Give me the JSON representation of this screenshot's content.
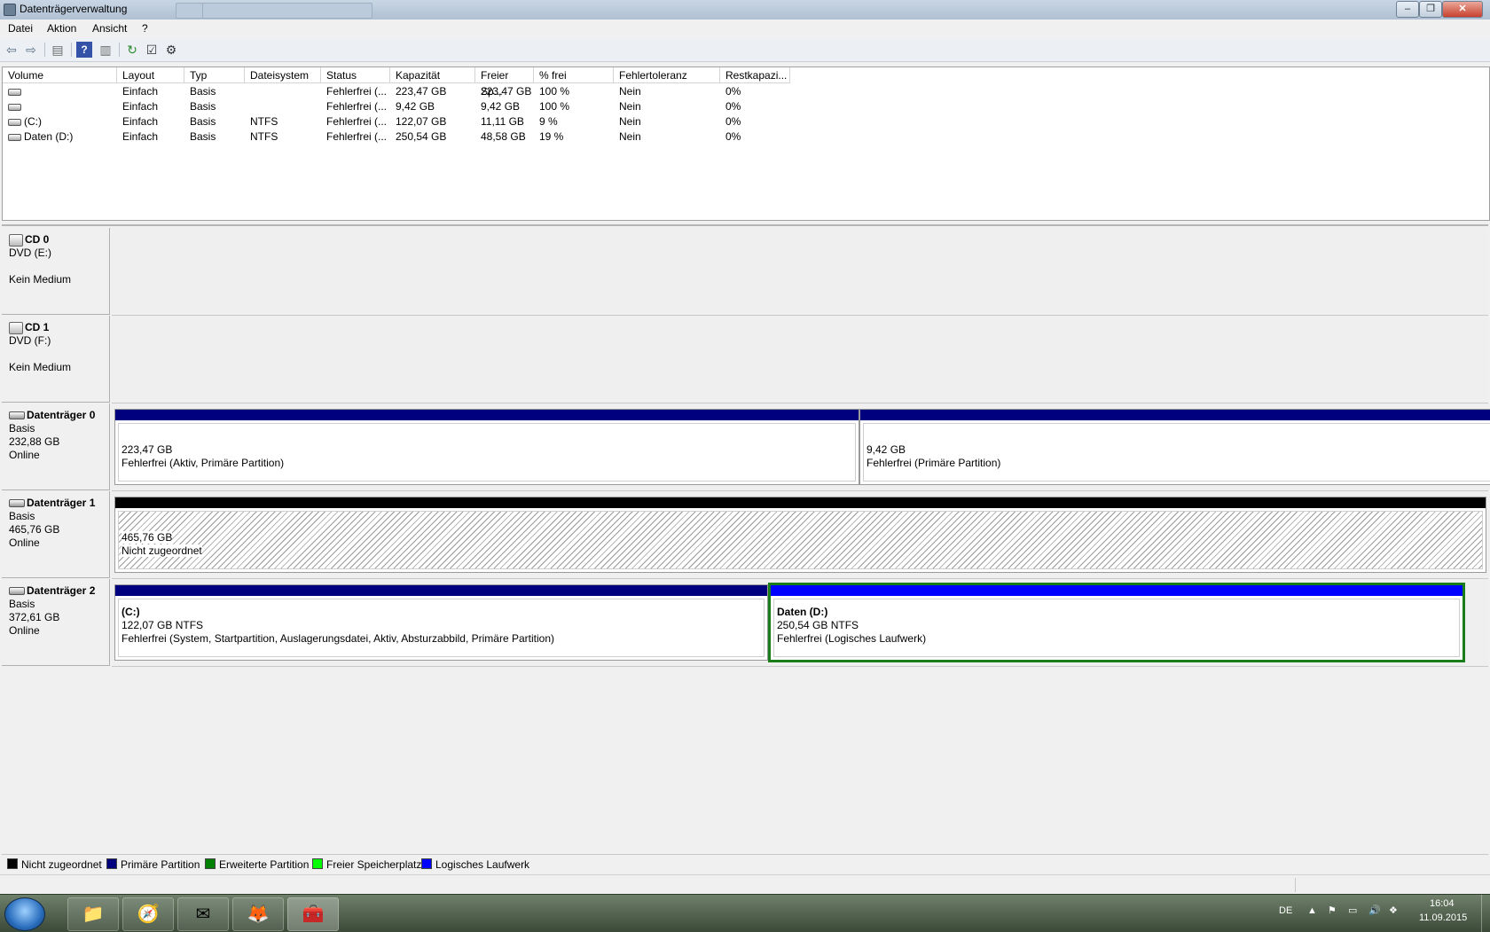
{
  "window": {
    "title": "Datenträgerverwaltung"
  },
  "menu": [
    "Datei",
    "Aktion",
    "Ansicht",
    "?"
  ],
  "toolbar": {
    "buttons": [
      "back-arrow-icon",
      "forward-arrow-icon",
      "console-tree-icon",
      "help-icon",
      "show-pane-icon",
      "refresh-icon",
      "properties-icon",
      "settings-icon"
    ]
  },
  "volume_table": {
    "columns": [
      "Volume",
      "Layout",
      "Typ",
      "Dateisystem",
      "Status",
      "Kapazität",
      "Freier Sp...",
      "% frei",
      "Fehlertoleranz",
      "Restkapazi..."
    ],
    "rows": [
      [
        "",
        "Einfach",
        "Basis",
        "",
        "Fehlerfrei (...",
        "223,47 GB",
        "223,47 GB",
        "100 %",
        "Nein",
        "0%"
      ],
      [
        "",
        "Einfach",
        "Basis",
        "",
        "Fehlerfrei (...",
        "9,42 GB",
        "9,42 GB",
        "100 %",
        "Nein",
        "0%"
      ],
      [
        "(C:)",
        "Einfach",
        "Basis",
        "NTFS",
        "Fehlerfrei (...",
        "122,07 GB",
        "11,11 GB",
        "9 %",
        "Nein",
        "0%"
      ],
      [
        "Daten (D:)",
        "Einfach",
        "Basis",
        "NTFS",
        "Fehlerfrei (...",
        "250,54 GB",
        "48,58 GB",
        "19 %",
        "Nein",
        "0%"
      ]
    ]
  },
  "disks": [
    {
      "name": "CD 0",
      "line1": "DVD (E:)",
      "line2": "",
      "line3": "Kein Medium"
    },
    {
      "name": "CD 1",
      "line1": "DVD (F:)",
      "line2": "",
      "line3": "Kein Medium"
    },
    {
      "name": "Datenträger 0",
      "line1": "Basis",
      "line2": "232,88 GB",
      "line3": "Online",
      "partitions": [
        {
          "title": "",
          "size": "223,47 GB",
          "status": "Fehlerfrei (Aktiv, Primäre Partition)"
        },
        {
          "title": "",
          "size": "9,42 GB",
          "status": "Fehlerfrei (Primäre Partition)"
        }
      ]
    },
    {
      "name": "Datenträger 1",
      "line1": "Basis",
      "line2": "465,76 GB",
      "line3": "Online",
      "partitions": [
        {
          "title": "",
          "size": "465,76 GB",
          "status": "Nicht zugeordnet"
        }
      ]
    },
    {
      "name": "Datenträger 2",
      "line1": "Basis",
      "line2": "372,61 GB",
      "line3": "Online",
      "partitions": [
        {
          "title": "(C:)",
          "size": "122,07 GB NTFS",
          "status": "Fehlerfrei (System, Startpartition, Auslagerungsdatei, Aktiv, Absturzabbild, Primäre Partition)"
        },
        {
          "title": "Daten  (D:)",
          "size": "250,54 GB NTFS",
          "status": "Fehlerfrei (Logisches Laufwerk)"
        }
      ]
    }
  ],
  "legend": [
    {
      "label": "Nicht zugeordnet",
      "color": "#000000"
    },
    {
      "label": "Primäre Partition",
      "color": "#00007f"
    },
    {
      "label": "Erweiterte Partition",
      "color": "#007f00"
    },
    {
      "label": "Freier Speicherplatz",
      "color": "#00ff00"
    },
    {
      "label": "Logisches Laufwerk",
      "color": "#0000ff"
    }
  ],
  "colors": {
    "primary": "#00007f",
    "logical": "#0000ff",
    "unallocated": "#000000",
    "selection": "#1a7d1a"
  },
  "taskbar": {
    "apps": [
      "windows-explorer-icon",
      "safari-icon",
      "thunderbird-icon",
      "firefox-icon",
      "toolbox-icon"
    ],
    "language": "DE",
    "time": "16:04",
    "date": "11.09.2015"
  }
}
